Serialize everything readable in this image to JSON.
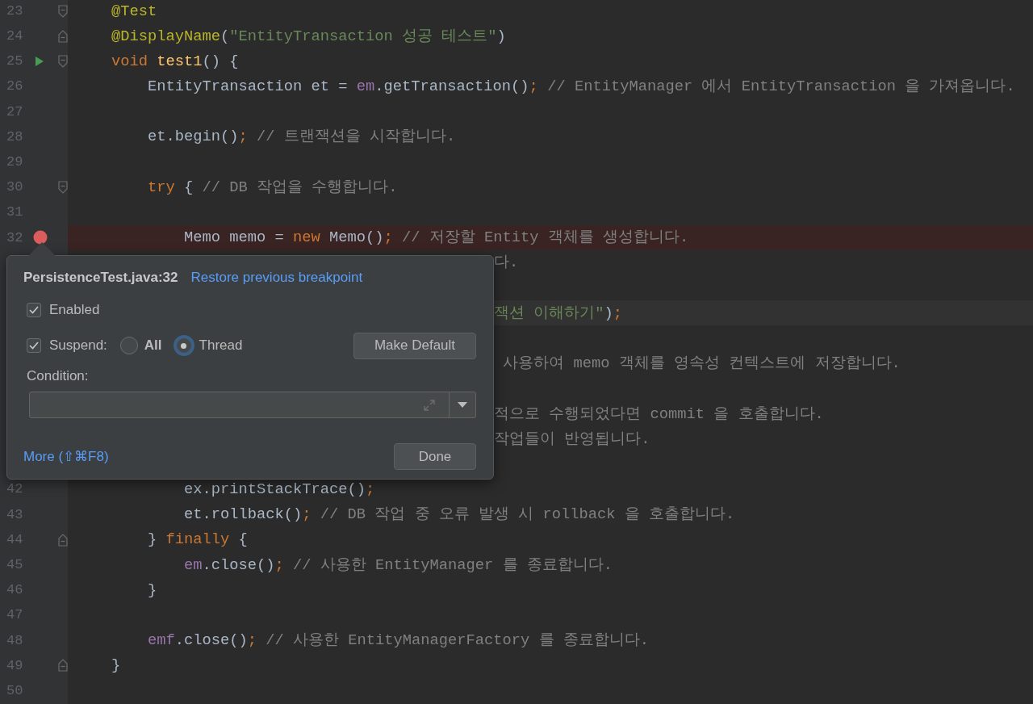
{
  "editor": {
    "lines": [
      {
        "kind": "code",
        "number": "23",
        "fold": {
          "kind": "start"
        },
        "tokens": [
          {
            "text": "    @Test",
            "kind": "annotation"
          }
        ]
      },
      {
        "kind": "code",
        "number": "24",
        "fold": {
          "kind": "end"
        },
        "tokens": [
          {
            "text": "    @DisplayName",
            "kind": "annotation"
          },
          {
            "text": "(",
            "kind": "plain"
          },
          {
            "text": "\"EntityTransaction 성공 테스트\"",
            "kind": "string"
          },
          {
            "text": ")",
            "kind": "plain"
          }
        ]
      },
      {
        "kind": "code",
        "number": "25",
        "fold": {
          "kind": "start"
        },
        "marker": {
          "kind": "run"
        },
        "tokens": [
          {
            "text": "    void ",
            "kind": "keyword"
          },
          {
            "text": "test1",
            "kind": "method"
          },
          {
            "text": "() {",
            "kind": "plain"
          }
        ]
      },
      {
        "kind": "code",
        "number": "26",
        "tokens": [
          {
            "text": "        EntityTransaction et = ",
            "kind": "plain"
          },
          {
            "text": "em",
            "kind": "field"
          },
          {
            "text": ".getTransaction()",
            "kind": "plain"
          },
          {
            "text": ";",
            "kind": "keyword"
          },
          {
            "text": " // EntityManager 에서 EntityTransaction 을 가져옵니다.",
            "kind": "comment"
          }
        ]
      },
      {
        "kind": "code",
        "number": "27"
      },
      {
        "kind": "code",
        "number": "28",
        "tokens": [
          {
            "text": "        et.begin()",
            "kind": "plain"
          },
          {
            "text": ";",
            "kind": "keyword"
          },
          {
            "text": " // 트랜잭션을 시작합니다.",
            "kind": "comment"
          }
        ]
      },
      {
        "kind": "code",
        "number": "29"
      },
      {
        "kind": "code",
        "number": "30",
        "fold": {
          "kind": "start"
        },
        "tokens": [
          {
            "text": "        try ",
            "kind": "keyword"
          },
          {
            "text": "{ ",
            "kind": "plain"
          },
          {
            "text": "// DB 작업을 수행합니다.",
            "kind": "comment"
          }
        ]
      },
      {
        "kind": "code",
        "number": "31"
      },
      {
        "kind": "code",
        "number": "32",
        "marker": {
          "kind": "breakpoint"
        },
        "tokens": [
          {
            "text": "            Memo memo = ",
            "kind": "plain"
          },
          {
            "text": "new ",
            "kind": "keyword"
          },
          {
            "text": "Memo()",
            "kind": "plain"
          },
          {
            "text": ";",
            "kind": "keyword"
          },
          {
            "text": " // 저장할 Entity 객체를 생성합니다.",
            "kind": "comment"
          }
        ]
      },
      {
        "kind": "clipped",
        "tokens": [
          {
            "text": "다.",
            "kind": "comment"
          }
        ]
      },
      {
        "kind": "clipped"
      },
      {
        "kind": "clipped",
        "current": true,
        "tokens": [
          {
            "text": "잭션 이해하기\"",
            "kind": "string"
          },
          {
            "text": ")",
            "kind": "plain"
          },
          {
            "text": ";",
            "kind": "keyword"
          }
        ]
      },
      {
        "kind": "clipped"
      },
      {
        "kind": "clipped",
        "tokens": [
          {
            "text": " 사용하여 memo 객체를 영속성 컨텍스트에 저장합니다.",
            "kind": "comment"
          }
        ]
      },
      {
        "kind": "clipped"
      },
      {
        "kind": "clipped",
        "tokens": [
          {
            "text": "적으로 수행되었다면 commit 을 호출합니다.",
            "kind": "comment"
          }
        ]
      },
      {
        "kind": "clipped",
        "tokens": [
          {
            "text": "작업들이 반영됩니다.",
            "kind": "comment"
          }
        ]
      },
      {
        "kind": "clipped"
      },
      {
        "kind": "code",
        "number": "42",
        "tokens": [
          {
            "text": "            ex.printStackTrace()",
            "kind": "plain"
          },
          {
            "text": ";",
            "kind": "keyword"
          }
        ]
      },
      {
        "kind": "code",
        "number": "43",
        "tokens": [
          {
            "text": "            et.rollback()",
            "kind": "plain"
          },
          {
            "text": ";",
            "kind": "keyword"
          },
          {
            "text": " // DB 작업 중 오류 발생 시 rollback 을 호출합니다.",
            "kind": "comment"
          }
        ]
      },
      {
        "kind": "code",
        "number": "44",
        "fold": {
          "kind": "end"
        },
        "tokens": [
          {
            "text": "        } ",
            "kind": "plain"
          },
          {
            "text": "finally ",
            "kind": "keyword"
          },
          {
            "text": "{",
            "kind": "plain"
          }
        ]
      },
      {
        "kind": "code",
        "number": "45",
        "tokens": [
          {
            "text": "            em",
            "kind": "field"
          },
          {
            "text": ".close()",
            "kind": "plain"
          },
          {
            "text": ";",
            "kind": "keyword"
          },
          {
            "text": " // 사용한 EntityManager 를 종료합니다.",
            "kind": "comment"
          }
        ]
      },
      {
        "kind": "code",
        "number": "46",
        "tokens": [
          {
            "text": "        }",
            "kind": "plain"
          }
        ]
      },
      {
        "kind": "code",
        "number": "47"
      },
      {
        "kind": "code",
        "number": "48",
        "tokens": [
          {
            "text": "        emf",
            "kind": "field"
          },
          {
            "text": ".close()",
            "kind": "plain"
          },
          {
            "text": ";",
            "kind": "keyword"
          },
          {
            "text": " // 사용한 EntityManagerFactory 를 종료합니다.",
            "kind": "comment"
          }
        ]
      },
      {
        "kind": "code",
        "number": "49",
        "fold": {
          "kind": "end"
        },
        "tokens": [
          {
            "text": "    }",
            "kind": "plain"
          }
        ]
      },
      {
        "kind": "code",
        "number": "50"
      }
    ]
  },
  "breakpoint_popup": {
    "title": "PersistenceTest.java:32",
    "restore_link": "Restore previous breakpoint",
    "enabled": {
      "label": "Enabled",
      "checked": true
    },
    "suspend": {
      "label": "Suspend:",
      "checked": true,
      "options": [
        {
          "label": "All",
          "selected": false,
          "is_default": true
        },
        {
          "label": "Thread",
          "selected": true,
          "is_default": false
        }
      ]
    },
    "make_default": "Make Default",
    "condition_label": "Condition:",
    "more_link": "More (⇧⌘F8)",
    "done": "Done"
  }
}
